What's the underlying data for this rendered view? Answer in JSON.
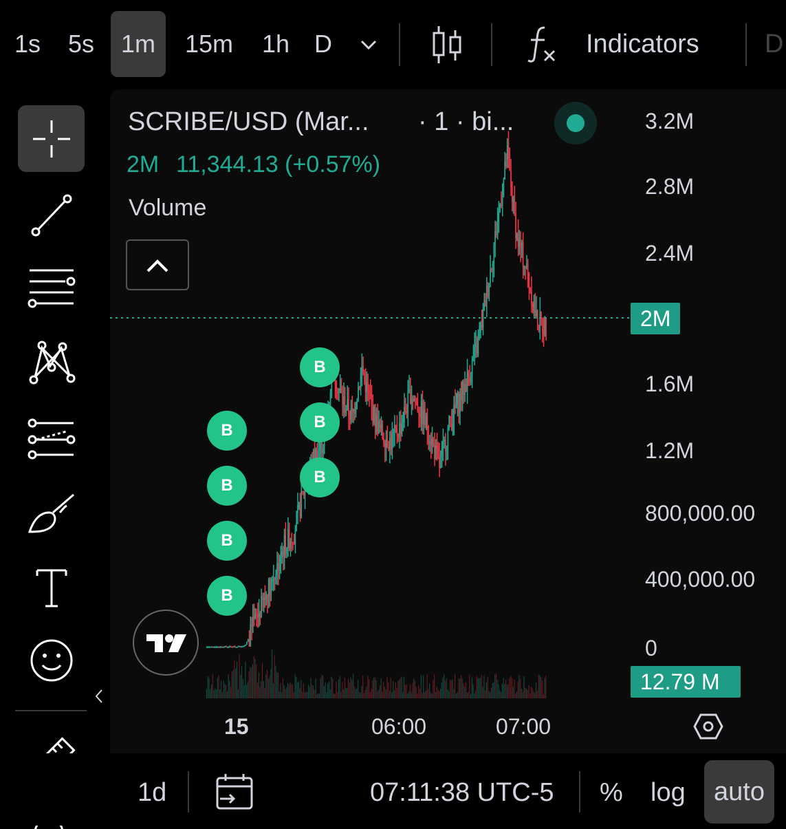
{
  "toolbar": {
    "timeframes": [
      "1s",
      "5s",
      "1m",
      "15m",
      "1h",
      "D"
    ],
    "active_timeframe": "1m",
    "indicators_label": "Indicators",
    "cut_label": "D"
  },
  "legend": {
    "symbol": "SCRIBE/USD (Mar...",
    "interval": "· 1 · bi...",
    "price_label": "2M",
    "price_value": "11,344.13 (+0.57%)",
    "volume_label": "Volume"
  },
  "price_axis": {
    "labels": [
      "3.2M",
      "2.8M",
      "2.4M",
      "1.6M",
      "1.2M",
      "800,000.00",
      "400,000.00",
      "0"
    ],
    "current_tag": "2M",
    "volume_tag": "12.79 M"
  },
  "time_axis": {
    "labels": [
      "15",
      "06:00",
      "07:00"
    ]
  },
  "markers": {
    "label": "B"
  },
  "bottom": {
    "range": "1d",
    "clock": "07:11:38 UTC-5",
    "percent": "%",
    "log": "log",
    "auto": "auto"
  },
  "colors": {
    "up": "#22ab94",
    "down": "#f23645",
    "accent": "#1e9c86",
    "marker": "#22c48a"
  },
  "chart_data": {
    "type": "candlestick",
    "title": "SCRIBE/USD",
    "ylim": [
      0,
      3200000
    ],
    "x_ticks": [
      "15",
      "06:00",
      "07:00"
    ],
    "current_price": 2000000,
    "approx_series": [
      {
        "name": "close",
        "values": [
          0,
          0,
          0,
          0,
          10000,
          150000,
          300000,
          450000,
          620000,
          700000,
          950000,
          1150000,
          1250000,
          1700000,
          1500000,
          1400000,
          1700000,
          1450000,
          1300000,
          1250000,
          1350000,
          1550000,
          1450000,
          1300000,
          1100000,
          1350000,
          1500000,
          1650000,
          1850000,
          2200000,
          2600000,
          3000000,
          2500000,
          2300000,
          2000000,
          1950000
        ]
      }
    ]
  }
}
